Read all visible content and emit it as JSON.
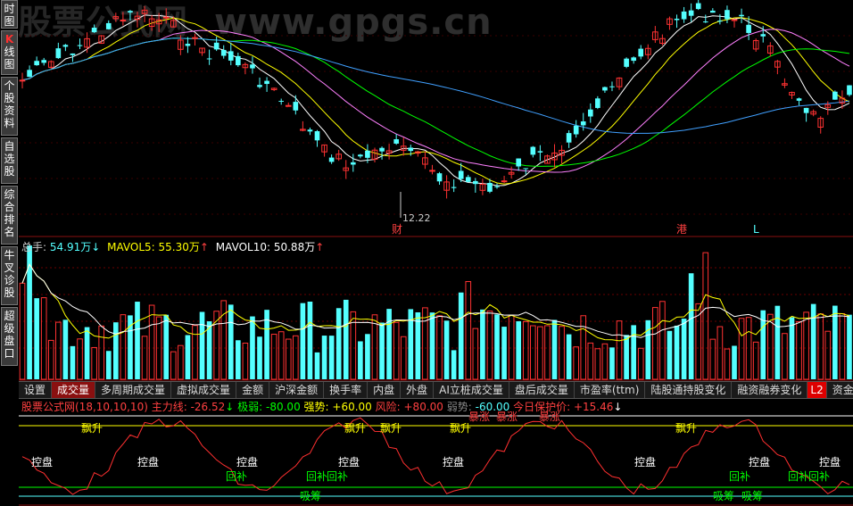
{
  "watermark": "www.gpgs.cn",
  "watermark_left": "股票公式网",
  "sidebar": {
    "tabs": [
      {
        "label": "时图"
      },
      {
        "label": "K线图",
        "k": "K",
        "rest": "线图"
      },
      {
        "label": "个股资料"
      },
      {
        "label": "自选股"
      },
      {
        "label": "综合排名"
      },
      {
        "label": "牛叉诊股"
      },
      {
        "label": "超级盘口"
      }
    ]
  },
  "kline": {
    "low_marker": "12.22",
    "event_marks": [
      "财",
      "港",
      "L"
    ],
    "colors": {
      "up": "#ff3232",
      "down": "#54ffff",
      "ma5": "#ffffff",
      "ma10": "#ffff00",
      "ma20": "#ff80ff",
      "ma30": "#00ff00",
      "ma60": "#40a0ff"
    }
  },
  "volume": {
    "total_label": "总手: ",
    "total_value": "54.91万",
    "total_arrow": "↓",
    "mavol5_label": "MAVOL5: ",
    "mavol5_value": "55.30万",
    "mavol5_arrow": "↑",
    "mavol10_label": "MAVOL10: ",
    "mavol10_value": "50.88万",
    "mavol10_arrow": "↑"
  },
  "tabs": [
    "设置",
    "成交量",
    "多周期成交量",
    "虚拟成交量",
    "金额",
    "沪深金额",
    "换手率",
    "内盘",
    "外盘",
    "AI立桩成交量",
    "盘后成交量",
    "市盈率(ttm)",
    "陆股通持股变化",
    "融资融券变化",
    "L2",
    "资金"
  ],
  "active_tab": "成交量",
  "indicator": {
    "name": "股票公式网(18,10,10,10)",
    "main_label": "主力线: ",
    "main_value": "-26.52",
    "main_arrow": "↓",
    "jiruo_label": "极弱: ",
    "jiruo_value": "-80.00",
    "qiang_label": "强势: ",
    "qiang_value": "+60.00",
    "fengxian_label": "风险: ",
    "fengxian_value": "+80.00",
    "ruo_label": "弱势: ",
    "ruo_value": "-60.00",
    "protect_label": "今日保护价: ",
    "protect_value": "+15.46",
    "protect_arrow": "↓",
    "signals": {
      "piaosheng": "飘升",
      "kongpan": "控盘",
      "huibu": "回补",
      "xichou": "吸筹",
      "baoman": "暴涨",
      "jianshe": "逃跑"
    }
  }
}
